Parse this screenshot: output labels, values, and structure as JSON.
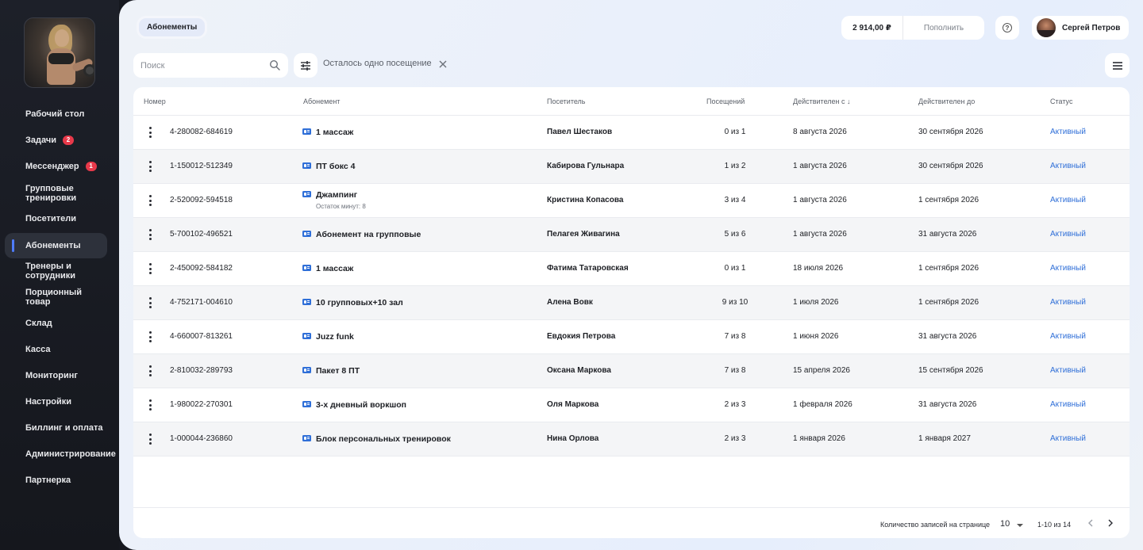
{
  "sidebar": {
    "items": [
      {
        "label": "Рабочий стол"
      },
      {
        "label": "Задачи",
        "badge": "2"
      },
      {
        "label": "Мессенджер",
        "badge": "1"
      },
      {
        "label": "Групповые тренировки"
      },
      {
        "label": "Посетители"
      },
      {
        "label": "Абонементы",
        "active": true
      },
      {
        "label": "Тренеры и сотрудники"
      },
      {
        "label": "Порционный товар"
      },
      {
        "label": "Склад"
      },
      {
        "label": "Касса"
      },
      {
        "label": "Мониторинг"
      },
      {
        "label": "Настройки"
      },
      {
        "label": "Биллинг и оплата"
      },
      {
        "label": "Администрирование"
      },
      {
        "label": "Партнерка"
      }
    ]
  },
  "header": {
    "page_title": "Абонементы",
    "balance": "2 914,00 ₽",
    "topup_label": "Пополнить",
    "help_icon": "?",
    "user_name": "Сергей Петров"
  },
  "toolbar": {
    "search_placeholder": "Поиск",
    "active_filter": "Осталось одно посещение"
  },
  "table": {
    "columns": [
      "Номер",
      "Абонемент",
      "Посетитель",
      "Посещений",
      "Действителен с ↓",
      "Действителен до",
      "Статус"
    ],
    "rows": [
      {
        "number": "4-280082-684619",
        "subscription": "1 массаж",
        "note": "",
        "visitor": "Павел Шестаков",
        "visits": "0 из 1",
        "from": "8 августа 2026",
        "to": "30 сентября 2026",
        "status": "Активный"
      },
      {
        "number": "1-150012-512349",
        "subscription": "ПТ бокс 4",
        "note": "",
        "visitor": "Кабирова Гульнара",
        "visits": "1 из 2",
        "from": "1 августа 2026",
        "to": "30 сентября 2026",
        "status": "Активный"
      },
      {
        "number": "2-520092-594518",
        "subscription": "Джампинг",
        "note": "Остаток минут: 8",
        "visitor": "Кристина Копасова",
        "visits": "3 из 4",
        "from": "1 августа 2026",
        "to": "1 сентября 2026",
        "status": "Активный"
      },
      {
        "number": "5-700102-496521",
        "subscription": "Абонемент на групповые",
        "note": "",
        "visitor": "Пелагея Живагина",
        "visits": "5 из 6",
        "from": "1 августа 2026",
        "to": "31 августа 2026",
        "status": "Активный"
      },
      {
        "number": "2-450092-584182",
        "subscription": "1 массаж",
        "note": "",
        "visitor": "Фатима Татаровская",
        "visits": "0 из 1",
        "from": "18 июля 2026",
        "to": "1 сентября 2026",
        "status": "Активный"
      },
      {
        "number": "4-752171-004610",
        "subscription": "10 групповых+10 зал",
        "note": "",
        "visitor": "Алена Вовк",
        "visits": "9 из 10",
        "from": "1 июля 2026",
        "to": "1 сентября 2026",
        "status": "Активный"
      },
      {
        "number": "4-660007-813261",
        "subscription": "Juzz funk",
        "note": "",
        "visitor": "Евдокия Петрова",
        "visits": "7 из 8",
        "from": "1 июня 2026",
        "to": "31 августа 2026",
        "status": "Активный"
      },
      {
        "number": "2-810032-289793",
        "subscription": "Пакет 8 ПТ",
        "note": "",
        "visitor": "Оксана Маркова",
        "visits": "7 из 8",
        "from": "15 апреля 2026",
        "to": "15 сентября 2026",
        "status": "Активный"
      },
      {
        "number": "1-980022-270301",
        "subscription": "3-х дневный воркшоп",
        "note": "",
        "visitor": "Оля Маркова",
        "visits": "2 из 3",
        "from": "1 февраля 2026",
        "to": "31 августа 2026",
        "status": "Активный"
      },
      {
        "number": "1-000044-236860",
        "subscription": "Блок персональных тренировок",
        "note": "",
        "visitor": "Нина Орлова",
        "visits": "2 из 3",
        "from": "1 января 2026",
        "to": "1 января 2027",
        "status": "Активный"
      }
    ]
  },
  "pagination": {
    "per_page_label": "Количество записей на странице",
    "per_page_value": "10",
    "range": "1-10 из 14"
  },
  "colors": {
    "accent": "#2f6fd8",
    "badge": "#e8394a",
    "sidebar_bg": "#1d2029"
  }
}
